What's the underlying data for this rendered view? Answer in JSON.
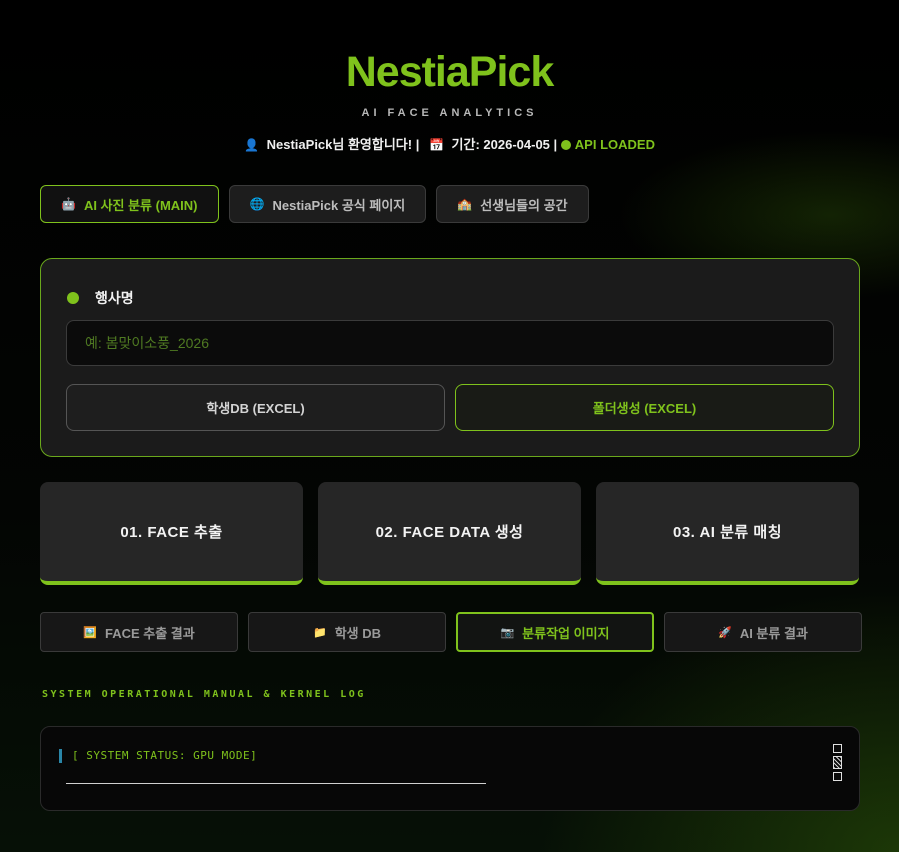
{
  "header": {
    "logo": "NestiaPick",
    "subtitle": "AI FACE ANALYTICS",
    "welcome": {
      "user_icon": "👤",
      "user_text": "NestiaPick님 환영합니다! |",
      "calendar_icon": "📅",
      "period_text": "기간: 2026-04-05 |",
      "api_status": "API LOADED",
      "api_status_color": "#7fc21c"
    }
  },
  "nav_tabs": [
    {
      "icon": "🤖",
      "label": "AI 사진 분류 (MAIN)",
      "active": true
    },
    {
      "icon": "🌐",
      "label": "NestiaPick 공식 페이지",
      "active": false
    },
    {
      "icon": "🏫",
      "label": "선생님들의 공간",
      "active": false
    }
  ],
  "event": {
    "label": "행사명",
    "input_value": "",
    "input_placeholder": "예: 봄맞이소풍_2026",
    "student_db_button": "학생DB (EXCEL)",
    "folder_button": "폴더생성 (EXCEL)"
  },
  "steps": [
    {
      "label": "01. FACE 추출"
    },
    {
      "label": "02. FACE DATA 생성"
    },
    {
      "label": "03. AI 분류 매칭"
    }
  ],
  "result_tabs": [
    {
      "icon": "🖼️",
      "label": "FACE 추출 결과",
      "active": false
    },
    {
      "icon": "📁",
      "label": "학생 DB",
      "active": false
    },
    {
      "icon": "📷",
      "label": "분류작업 이미지",
      "active": true
    },
    {
      "icon": "🚀",
      "label": "AI 분류 결과",
      "active": false
    }
  ],
  "manual": {
    "title": "SYSTEM OPERATIONAL MANUAL & KERNEL LOG",
    "log_line": "[ SYSTEM STATUS: GPU MODE]"
  },
  "colors": {
    "accent": "#7fc21c",
    "background": "#000000",
    "card": "#1b1b1b"
  }
}
